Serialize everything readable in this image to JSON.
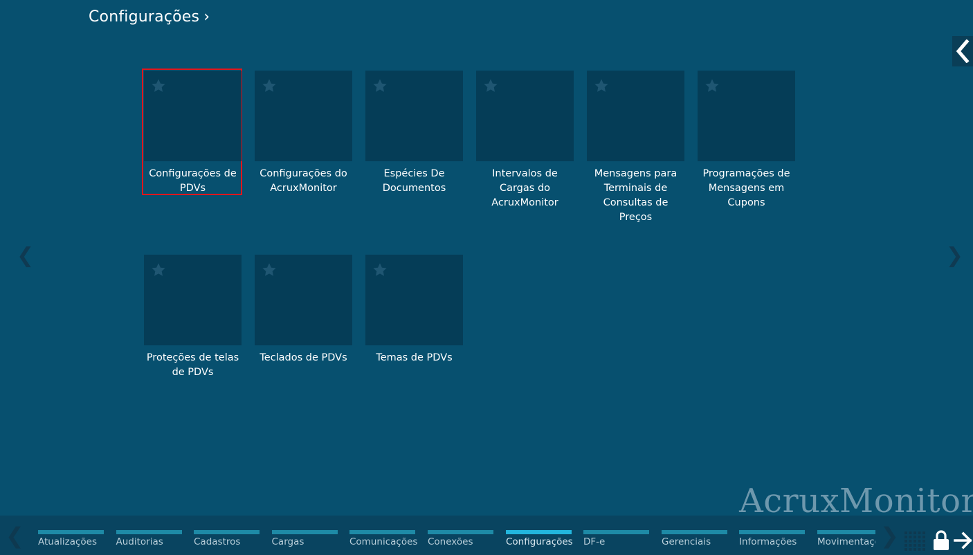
{
  "header": {
    "title": "Configurações",
    "chevron": "›"
  },
  "side_panel": {
    "icon": "chevron-left-icon"
  },
  "nav": {
    "prev": "❮",
    "next": "❯"
  },
  "tiles": [
    {
      "label": "Configurações de PDVs",
      "selected": true
    },
    {
      "label": "Configurações do AcruxMonitor"
    },
    {
      "label": "Espécies De Documentos"
    },
    {
      "label": "Intervalos de Cargas do AcruxMonitor"
    },
    {
      "label": "Mensagens para Terminais de Consultas de Preços"
    },
    {
      "label": "Programações de Mensagens em Cupons"
    },
    {
      "label": "Proteções de telas de PDVs"
    },
    {
      "label": "Teclados de PDVs"
    },
    {
      "label": "Temas de PDVs"
    }
  ],
  "brand": "AcruxMonitor",
  "bottom_bar": {
    "prev": "❮",
    "next": "❯",
    "tabs": [
      {
        "label": "Atualizações"
      },
      {
        "label": "Auditorias"
      },
      {
        "label": "Cadastros"
      },
      {
        "label": "Cargas"
      },
      {
        "label": "Comunicações"
      },
      {
        "label": "Conexões"
      },
      {
        "label": "Configurações",
        "active": true
      },
      {
        "label": "DF-e"
      },
      {
        "label": "Gerenciais"
      },
      {
        "label": "Informações"
      },
      {
        "label": "Movimentações"
      }
    ],
    "icons": [
      "grid-icon",
      "lock-icon",
      "logout-arrow-icon"
    ]
  },
  "colors": {
    "background": "#07506f",
    "tile": "#053d57",
    "selection": "#e0161c",
    "tab_bar": "#1e8aa6",
    "tab_bar_active": "#22b6dd"
  }
}
